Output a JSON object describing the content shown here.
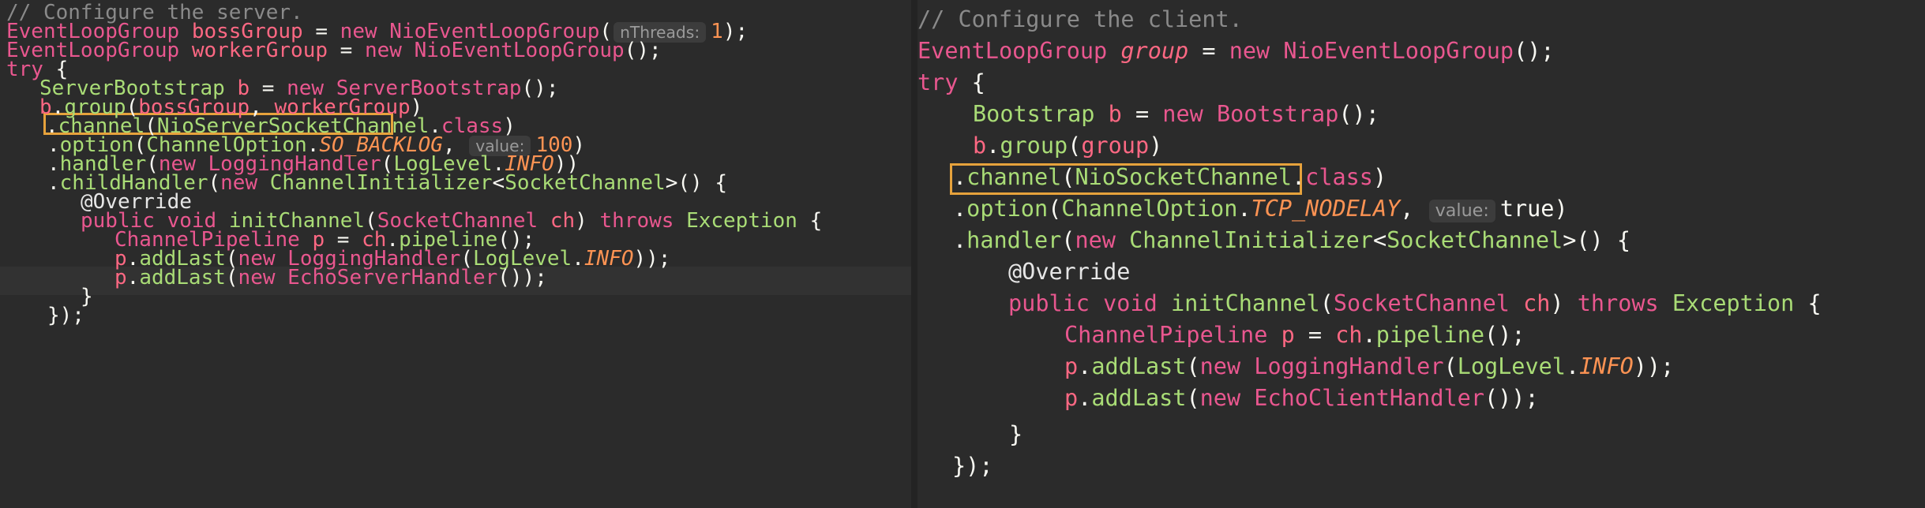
{
  "left": {
    "comment": "// Configure the server.",
    "l1": {
      "t1": "EventLoopGroup",
      "v": "bossGroup",
      "op": "=",
      "kw": "new",
      "cls": "NioEventLoopGroup",
      "open": "(",
      "hint": "nThreads:",
      "num": "1",
      "close": ");"
    },
    "l2": {
      "t1": "EventLoopGroup",
      "v": "workerGroup",
      "op": "=",
      "kw": "new",
      "cls": "NioEventLoopGroup",
      "rest": "();"
    },
    "l3": {
      "kw": "try",
      "rest": "{"
    },
    "l4": {
      "t1": "ServerBootstrap",
      "v": "b",
      "op": "=",
      "kw": "new",
      "cls": "ServerBootstrap",
      "rest": "();"
    },
    "l5": {
      "v": "b",
      "dot": ".",
      "fn": "group",
      "open": "(",
      "a1": "bossGroup",
      "sep": ",",
      "a2": "workerGroup",
      "close": ")"
    },
    "l6": {
      "dot": ".",
      "fn": "channel",
      "open": "(",
      "cls": "NioServerSocketChannel",
      "dot2": ".",
      "kw": "class",
      "close": ")"
    },
    "l7": {
      "dot": ".",
      "fn": "option",
      "open": "(",
      "cls": "ChannelOption",
      "dot2": ".",
      "c": "SO_BACKLOG",
      "sep": ",",
      "hint": "value:",
      "num": "100",
      "close": ")"
    },
    "l8": {
      "dot": ".",
      "fn": "handler",
      "open": "(",
      "kw": "new",
      "cls": "LoggingHandler",
      "open2": "(",
      "cls2": "LogLevel",
      "dot2": ".",
      "c": "INFO",
      "close": "))"
    },
    "l9": {
      "dot": ".",
      "fn": "childHandler",
      "open": "(",
      "kw": "new",
      "cls": "ChannelInitializer",
      "lt": "<",
      "tp": "SocketChannel",
      "gt": ">",
      "rest": "() {"
    },
    "l10": {
      "ann": "@Override"
    },
    "l11": {
      "kw1": "public",
      "kw2": "void",
      "fn": "initChannel",
      "open": "(",
      "cls": "SocketChannel",
      "v": "ch",
      "close": ")",
      "kw3": "throws",
      "ex": "Exception",
      "brace": "{"
    },
    "l12": {
      "t1": "ChannelPipeline",
      "v": "p",
      "op": "=",
      "v2": "ch",
      "dot": ".",
      "fn": "pipeline",
      "rest": "();"
    },
    "l13": {
      "v": "p",
      "dot": ".",
      "fn": "addLast",
      "open": "(",
      "kw": "new",
      "cls": "LoggingHandler",
      "open2": "(",
      "cls2": "LogLevel",
      "dot2": ".",
      "c": "INFO",
      "close": "));"
    },
    "l14": {
      "v": "p",
      "dot": ".",
      "fn": "addLast",
      "open": "(",
      "kw": "new",
      "cls": "EchoServerHandler",
      "close": "());"
    },
    "l15": {
      "rest": "}"
    },
    "l16": {
      "rest": "});"
    }
  },
  "right": {
    "comment": "// Configure the client.",
    "l1": {
      "t1": "EventLoopGroup",
      "v": "group",
      "op": "=",
      "kw": "new",
      "cls": "NioEventLoopGroup",
      "rest": "();"
    },
    "l2": {
      "kw": "try",
      "rest": "{"
    },
    "l3": {
      "t1": "Bootstrap",
      "v": "b",
      "op": "=",
      "kw": "new",
      "cls": "Bootstrap",
      "rest": "();"
    },
    "l4": {
      "v": "b",
      "dot": ".",
      "fn": "group",
      "open": "(",
      "a1": "group",
      "close": ")"
    },
    "l5": {
      "dot": ".",
      "fn": "channel",
      "open": "(",
      "cls": "NioSocketChannel",
      "dot2": ".",
      "kw": "class",
      "close": ")"
    },
    "l6": {
      "dot": ".",
      "fn": "option",
      "open": "(",
      "cls": "ChannelOption",
      "dot2": ".",
      "c": "TCP_NODELAY",
      "sep": ",",
      "hint": "value:",
      "val": "true",
      "close": ")"
    },
    "l7": {
      "dot": ".",
      "fn": "handler",
      "open": "(",
      "kw": "new",
      "cls": "ChannelInitializer",
      "lt": "<",
      "tp": "SocketChannel",
      "gt": ">",
      "rest": "() {"
    },
    "l8": {
      "ann": "@Override"
    },
    "l9": {
      "kw1": "public",
      "kw2": "void",
      "fn": "initChannel",
      "open": "(",
      "cls": "SocketChannel",
      "v": "ch",
      "close": ")",
      "kw3": "throws",
      "ex": "Exception",
      "brace": "{"
    },
    "l10": {
      "t1": "ChannelPipeline",
      "v": "p",
      "op": "=",
      "v2": "ch",
      "dot": ".",
      "fn": "pipeline",
      "rest": "();"
    },
    "l11": {
      "v": "p",
      "dot": ".",
      "fn": "addLast",
      "open": "(",
      "kw": "new",
      "cls": "LoggingHandler",
      "open2": "(",
      "cls2": "LogLevel",
      "dot2": ".",
      "c": "INFO",
      "close": "));"
    },
    "l12": {
      "v": "p",
      "dot": ".",
      "fn": "addLast",
      "open": "(",
      "kw": "new",
      "cls": "EchoClientHandler",
      "close": "());"
    },
    "l13": {
      "rest": "}"
    },
    "l14": {
      "rest": "});"
    }
  },
  "colors": {
    "background": "#2b2b2b",
    "highlight_box": "#e6a23c",
    "comment": "#8a8a8a",
    "keyword": "#e9578f",
    "class": "#a9dc76",
    "constant": "#fd9353"
  }
}
